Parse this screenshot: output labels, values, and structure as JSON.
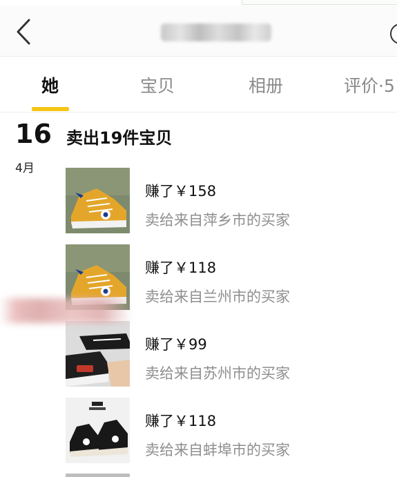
{
  "nav": {
    "back_icon": "chevron-left-icon",
    "more_icon": "info-circle-icon"
  },
  "tabs": [
    {
      "label": "她",
      "active": true
    },
    {
      "label": "宝贝",
      "active": false
    },
    {
      "label": "相册",
      "active": false
    },
    {
      "label": "评价·5",
      "active": false
    }
  ],
  "colors": {
    "accent": "#f5c518",
    "muted_text": "#8e8e8e"
  },
  "date": {
    "day": "16",
    "month": "4月"
  },
  "summary": "卖出19件宝贝",
  "items": [
    {
      "earned": "赚了￥158",
      "buyer": "卖给来自萍乡市的买家",
      "thumb_icon": "yellow-sneaker-image"
    },
    {
      "earned": "赚了￥118",
      "buyer": "卖给来自兰州市的买家",
      "thumb_icon": "yellow-sneaker-image"
    },
    {
      "earned": "赚了￥99",
      "buyer": "卖给来自苏州市的买家",
      "thumb_icon": "black-sneaker-image"
    },
    {
      "earned": "赚了￥118",
      "buyer": "卖给来自蚌埠市的买家",
      "thumb_icon": "black-hightop-sneaker-image"
    }
  ]
}
